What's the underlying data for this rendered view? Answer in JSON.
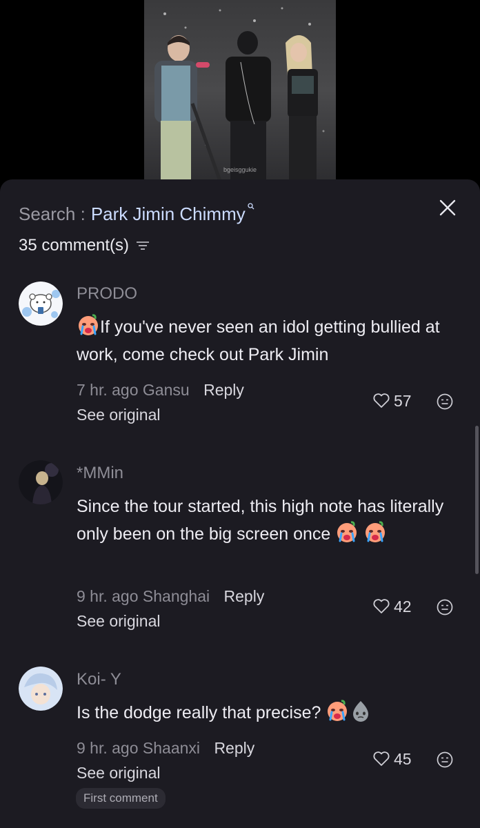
{
  "video": {
    "watermark": "bgeisggukie"
  },
  "search": {
    "prefix": "Search :",
    "query": "Park Jimin Chimmy"
  },
  "comments_header": {
    "count_label": "35 comment(s)"
  },
  "comments": [
    {
      "username": "PRODO",
      "text": "If you've never seen an idol getting bullied at work, come check out Park Jimin",
      "time": "7 hr. ago",
      "location": "Gansu",
      "reply_label": "Reply",
      "see_original_label": "See original",
      "likes": "57"
    },
    {
      "username": "*MMin",
      "text": "Since the tour started, this high note has literally only been on the big screen once",
      "time": "9 hr. ago",
      "location": "Shanghai",
      "reply_label": "Reply",
      "see_original_label": "See original",
      "likes": "42"
    },
    {
      "username": "Koi- Y",
      "text": "Is the dodge really that precise?",
      "time": "9 hr. ago",
      "location": "Shaanxi",
      "reply_label": "Reply",
      "see_original_label": "See original",
      "likes": "45",
      "badge": "First comment"
    }
  ],
  "icons": {
    "close": "close-icon",
    "sort": "sort-icon",
    "like": "heart-icon",
    "dislike": "dislike-face-icon",
    "crying_emoji": "crying-face-emoji",
    "sweat_emoji": "sweat-drop-emoji"
  },
  "colors": {
    "sheet_bg": "#1c1b22",
    "query_text": "#ccdcff",
    "muted_text": "#8e8d96"
  }
}
